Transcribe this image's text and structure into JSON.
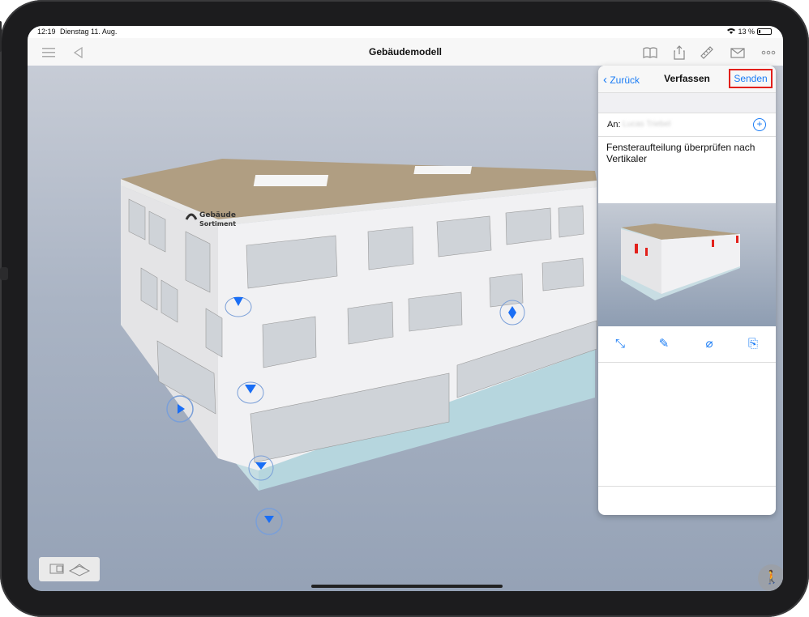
{
  "status_bar": {
    "time": "12:19",
    "date": "Dienstag 11. Aug.",
    "battery": "13 %"
  },
  "toolbar": {
    "title": "Gebäudemodell"
  },
  "building_sign": {
    "line1": "Gebäude",
    "line2": "Sortiment"
  },
  "compose_panel": {
    "back_label": "Zurück",
    "title": "Verfassen",
    "send_label": "Senden",
    "to_label": "An:",
    "recipient": "Lucas Triebel",
    "message": "Fensteraufteilung überprüfen nach Vertikaler"
  },
  "colors": {
    "accent": "#1a7cf5",
    "highlight": "#e2201b",
    "marker": "#1a6ef5"
  },
  "icons": [
    "menu-icon",
    "back-arrow-icon",
    "book-icon",
    "share-icon",
    "ruler-icon",
    "mail-icon",
    "more-icon",
    "plus-circle-icon",
    "crop-icon",
    "pen-icon",
    "eraser-icon",
    "attachment-icon",
    "walk-icon"
  ]
}
